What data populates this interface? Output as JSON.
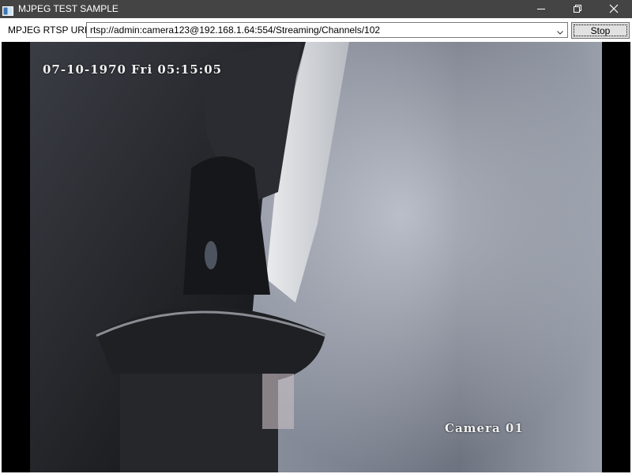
{
  "window": {
    "title": "MJPEG TEST SAMPLE",
    "icon": "app-window-icon",
    "controls": [
      "minimize-icon",
      "restore-icon",
      "close-icon"
    ],
    "titlebar_color": "#444444"
  },
  "toolbar": {
    "uri_label": "MPJEG RTSP URI :",
    "uri_value": "rtsp://admin:camera123@192.168.1.64:554/Streaming/Channels/102",
    "stop_label": "Stop"
  },
  "video": {
    "timestamp": "07-10-1970 Fri 05:15:05",
    "camera_label": "Camera 01"
  }
}
